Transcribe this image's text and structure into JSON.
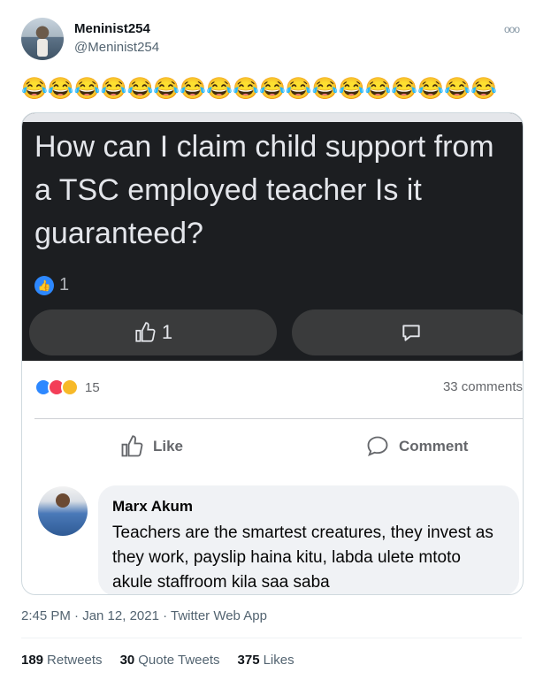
{
  "tweet": {
    "display_name": "Meninist254",
    "handle": "@Meninist254",
    "emoji_text": "😂😂😂😂😂😂😂😂😂😂😂😂😂😂😂😂😂😂",
    "timestamp": "2:45 PM · Jan 12, 2021 · Twitter Web App"
  },
  "post": {
    "question": "How can I claim child support from a TSC employed teacher Is it guaranteed?",
    "like_count": "1",
    "like_pill_count": "1",
    "reaction_count": "15",
    "comments_count": "33 comments",
    "like_label": "Like",
    "comment_label": "Comment"
  },
  "comment": {
    "author": "Marx Akum",
    "text": "Teachers are the smartest creatures,  they invest as they work, payslip haina kitu, labda ulete mtoto akule staffroom  kila saa saba"
  },
  "stats": [
    {
      "value": "189",
      "label": "Retweets"
    },
    {
      "value": "30",
      "label": "Quote Tweets"
    },
    {
      "value": "375",
      "label": "Likes"
    }
  ],
  "colors": {
    "facebook_blue": "#2d88ff",
    "dark_bg": "#1c1e21",
    "muted": "#536471"
  },
  "icons": [
    "more-icon",
    "thumbs-up-icon",
    "comment-icon"
  ]
}
